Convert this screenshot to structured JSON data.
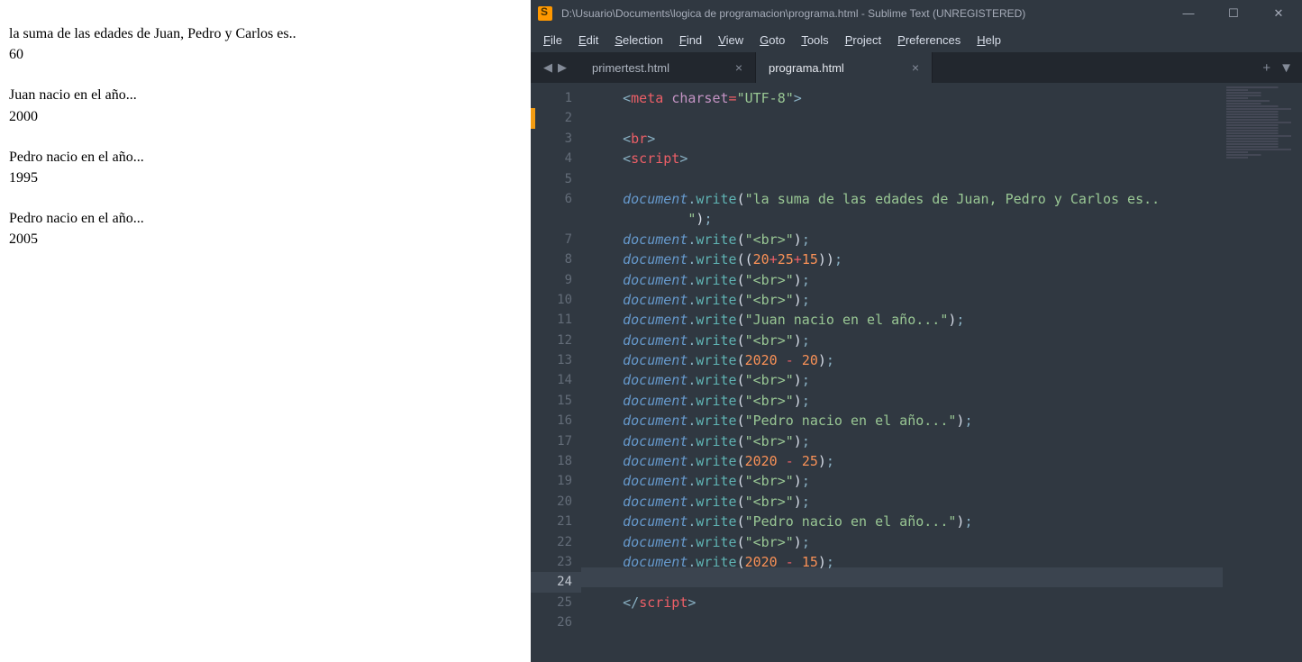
{
  "browser": {
    "line1": "la suma de las edades de Juan, Pedro y Carlos es..",
    "val1": "60",
    "line2": "Juan nacio en el año...",
    "val2": "2000",
    "line3": "Pedro nacio en el año...",
    "val3": "1995",
    "line4": "Pedro nacio en el año...",
    "val4": "2005"
  },
  "sublime": {
    "title": "D:\\Usuario\\Documents\\logica de programacion\\programa.html - Sublime Text (UNREGISTERED)",
    "menu": [
      "File",
      "Edit",
      "Selection",
      "Find",
      "View",
      "Goto",
      "Tools",
      "Project",
      "Preferences",
      "Help"
    ],
    "tabs": [
      {
        "label": "primertest.html",
        "active": false
      },
      {
        "label": "programa.html",
        "active": true
      }
    ],
    "active_line": 24,
    "gutter_marks": [
      2,
      24
    ],
    "code": [
      {
        "n": 1,
        "tokens": [
          [
            "<",
            "punc"
          ],
          [
            "meta",
            "tag"
          ],
          [
            " ",
            "def"
          ],
          [
            "charset",
            "attr"
          ],
          [
            "=",
            "op"
          ],
          [
            "\"UTF-8\"",
            "str"
          ],
          [
            ">",
            "punc"
          ]
        ]
      },
      {
        "n": 2,
        "tokens": []
      },
      {
        "n": 3,
        "tokens": [
          [
            "<",
            "punc"
          ],
          [
            "br",
            "tag"
          ],
          [
            ">",
            "punc"
          ]
        ]
      },
      {
        "n": 4,
        "tokens": [
          [
            "<",
            "punc"
          ],
          [
            "script",
            "tag"
          ],
          [
            ">",
            "punc"
          ]
        ]
      },
      {
        "n": 5,
        "tokens": []
      },
      {
        "n": 6,
        "tokens": [
          [
            "document",
            "obj"
          ],
          [
            ".",
            "punc"
          ],
          [
            "write",
            "meth"
          ],
          [
            "(",
            "def"
          ],
          [
            "\"la suma de las edades de Juan, Pedro y Carlos es..",
            "str"
          ]
        ]
      },
      {
        "n": "6b",
        "cont": true,
        "tokens": [
          [
            "    \"",
            "str"
          ],
          [
            ")",
            "def"
          ],
          [
            ";",
            "punc"
          ]
        ]
      },
      {
        "n": 7,
        "tokens": [
          [
            "document",
            "obj"
          ],
          [
            ".",
            "punc"
          ],
          [
            "write",
            "meth"
          ],
          [
            "(",
            "def"
          ],
          [
            "\"<br>\"",
            "str"
          ],
          [
            ")",
            "def"
          ],
          [
            ";",
            "punc"
          ]
        ]
      },
      {
        "n": 8,
        "tokens": [
          [
            "document",
            "obj"
          ],
          [
            ".",
            "punc"
          ],
          [
            "write",
            "meth"
          ],
          [
            "((",
            "def"
          ],
          [
            "20",
            "num"
          ],
          [
            "+",
            "op"
          ],
          [
            "25",
            "num"
          ],
          [
            "+",
            "op"
          ],
          [
            "15",
            "num"
          ],
          [
            "))",
            "def"
          ],
          [
            ";",
            "punc"
          ]
        ]
      },
      {
        "n": 9,
        "tokens": [
          [
            "document",
            "obj"
          ],
          [
            ".",
            "punc"
          ],
          [
            "write",
            "meth"
          ],
          [
            "(",
            "def"
          ],
          [
            "\"<br>\"",
            "str"
          ],
          [
            ")",
            "def"
          ],
          [
            ";",
            "punc"
          ]
        ]
      },
      {
        "n": 10,
        "tokens": [
          [
            "document",
            "obj"
          ],
          [
            ".",
            "punc"
          ],
          [
            "write",
            "meth"
          ],
          [
            "(",
            "def"
          ],
          [
            "\"<br>\"",
            "str"
          ],
          [
            ")",
            "def"
          ],
          [
            ";",
            "punc"
          ]
        ]
      },
      {
        "n": 11,
        "tokens": [
          [
            "document",
            "obj"
          ],
          [
            ".",
            "punc"
          ],
          [
            "write",
            "meth"
          ],
          [
            "(",
            "def"
          ],
          [
            "\"Juan nacio en el año...\"",
            "str"
          ],
          [
            ")",
            "def"
          ],
          [
            ";",
            "punc"
          ]
        ]
      },
      {
        "n": 12,
        "tokens": [
          [
            "document",
            "obj"
          ],
          [
            ".",
            "punc"
          ],
          [
            "write",
            "meth"
          ],
          [
            "(",
            "def"
          ],
          [
            "\"<br>\"",
            "str"
          ],
          [
            ")",
            "def"
          ],
          [
            ";",
            "punc"
          ]
        ]
      },
      {
        "n": 13,
        "tokens": [
          [
            "document",
            "obj"
          ],
          [
            ".",
            "punc"
          ],
          [
            "write",
            "meth"
          ],
          [
            "(",
            "def"
          ],
          [
            "2020",
            "num"
          ],
          [
            " ",
            "def"
          ],
          [
            "-",
            "op"
          ],
          [
            " ",
            "def"
          ],
          [
            "20",
            "num"
          ],
          [
            ")",
            "def"
          ],
          [
            ";",
            "punc"
          ]
        ]
      },
      {
        "n": 14,
        "tokens": [
          [
            "document",
            "obj"
          ],
          [
            ".",
            "punc"
          ],
          [
            "write",
            "meth"
          ],
          [
            "(",
            "def"
          ],
          [
            "\"<br>\"",
            "str"
          ],
          [
            ")",
            "def"
          ],
          [
            ";",
            "punc"
          ]
        ]
      },
      {
        "n": 15,
        "tokens": [
          [
            "document",
            "obj"
          ],
          [
            ".",
            "punc"
          ],
          [
            "write",
            "meth"
          ],
          [
            "(",
            "def"
          ],
          [
            "\"<br>\"",
            "str"
          ],
          [
            ")",
            "def"
          ],
          [
            ";",
            "punc"
          ]
        ]
      },
      {
        "n": 16,
        "tokens": [
          [
            "document",
            "obj"
          ],
          [
            ".",
            "punc"
          ],
          [
            "write",
            "meth"
          ],
          [
            "(",
            "def"
          ],
          [
            "\"Pedro nacio en el año...\"",
            "str"
          ],
          [
            ")",
            "def"
          ],
          [
            ";",
            "punc"
          ]
        ]
      },
      {
        "n": 17,
        "tokens": [
          [
            "document",
            "obj"
          ],
          [
            ".",
            "punc"
          ],
          [
            "write",
            "meth"
          ],
          [
            "(",
            "def"
          ],
          [
            "\"<br>\"",
            "str"
          ],
          [
            ")",
            "def"
          ],
          [
            ";",
            "punc"
          ]
        ]
      },
      {
        "n": 18,
        "tokens": [
          [
            "document",
            "obj"
          ],
          [
            ".",
            "punc"
          ],
          [
            "write",
            "meth"
          ],
          [
            "(",
            "def"
          ],
          [
            "2020",
            "num"
          ],
          [
            " ",
            "def"
          ],
          [
            "-",
            "op"
          ],
          [
            " ",
            "def"
          ],
          [
            "25",
            "num"
          ],
          [
            ")",
            "def"
          ],
          [
            ";",
            "punc"
          ]
        ]
      },
      {
        "n": 19,
        "tokens": [
          [
            "document",
            "obj"
          ],
          [
            ".",
            "punc"
          ],
          [
            "write",
            "meth"
          ],
          [
            "(",
            "def"
          ],
          [
            "\"<br>\"",
            "str"
          ],
          [
            ")",
            "def"
          ],
          [
            ";",
            "punc"
          ]
        ]
      },
      {
        "n": 20,
        "tokens": [
          [
            "document",
            "obj"
          ],
          [
            ".",
            "punc"
          ],
          [
            "write",
            "meth"
          ],
          [
            "(",
            "def"
          ],
          [
            "\"<br>\"",
            "str"
          ],
          [
            ")",
            "def"
          ],
          [
            ";",
            "punc"
          ]
        ]
      },
      {
        "n": 21,
        "tokens": [
          [
            "document",
            "obj"
          ],
          [
            ".",
            "punc"
          ],
          [
            "write",
            "meth"
          ],
          [
            "(",
            "def"
          ],
          [
            "\"Pedro nacio en el año...\"",
            "str"
          ],
          [
            ")",
            "def"
          ],
          [
            ";",
            "punc"
          ]
        ]
      },
      {
        "n": 22,
        "tokens": [
          [
            "document",
            "obj"
          ],
          [
            ".",
            "punc"
          ],
          [
            "write",
            "meth"
          ],
          [
            "(",
            "def"
          ],
          [
            "\"<br>\"",
            "str"
          ],
          [
            ")",
            "def"
          ],
          [
            ";",
            "punc"
          ]
        ]
      },
      {
        "n": 23,
        "tokens": [
          [
            "document",
            "obj"
          ],
          [
            ".",
            "punc"
          ],
          [
            "write",
            "meth"
          ],
          [
            "(",
            "def"
          ],
          [
            "2020",
            "num"
          ],
          [
            " ",
            "def"
          ],
          [
            "-",
            "op"
          ],
          [
            " ",
            "def"
          ],
          [
            "15",
            "num"
          ],
          [
            ")",
            "def"
          ],
          [
            ";",
            "punc"
          ]
        ]
      },
      {
        "n": 24,
        "tokens": []
      },
      {
        "n": 25,
        "tokens": [
          [
            "</",
            "punc"
          ],
          [
            "script",
            "tag"
          ],
          [
            ">",
            "punc"
          ]
        ]
      },
      {
        "n": 26,
        "tokens": []
      }
    ]
  }
}
